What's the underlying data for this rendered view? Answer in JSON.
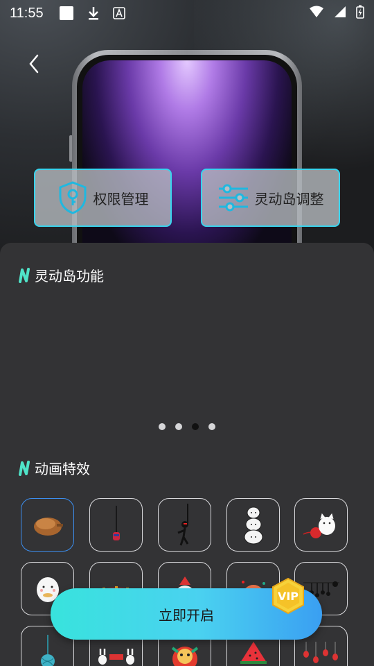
{
  "status_bar": {
    "time": "11:55"
  },
  "actions": {
    "permission": "权限管理",
    "island_adjust": "灵动岛调整"
  },
  "sections": {
    "island_features": "灵动岛功能",
    "animation_effects": "动画特效"
  },
  "carousel": {
    "dot_count": 4,
    "active_index": 2
  },
  "cta": {
    "label": "立即开启",
    "badge": "VIP"
  },
  "colors": {
    "accent": "#38d4ee",
    "panel": "#333335",
    "selected": "#3c8ff0"
  },
  "effects": [
    {
      "icon": "bread-icon"
    },
    {
      "icon": "hanging-spider-icon"
    },
    {
      "icon": "ninja-rope-icon"
    },
    {
      "icon": "stacked-bears-icon"
    },
    {
      "icon": "cat-yarn-icon"
    },
    {
      "icon": "bear-bow-icon"
    },
    {
      "icon": "firecracker-icon"
    },
    {
      "icon": "bear-hat-icon"
    },
    {
      "icon": "lion-face-icon"
    },
    {
      "icon": "hanging-bats-icon"
    },
    {
      "icon": "yarn-ball-icon"
    },
    {
      "icon": "rabbits-banner-icon"
    },
    {
      "icon": "lion-dance-icon"
    },
    {
      "icon": "watermelon-icon"
    },
    {
      "icon": "lanterns-icon"
    }
  ]
}
